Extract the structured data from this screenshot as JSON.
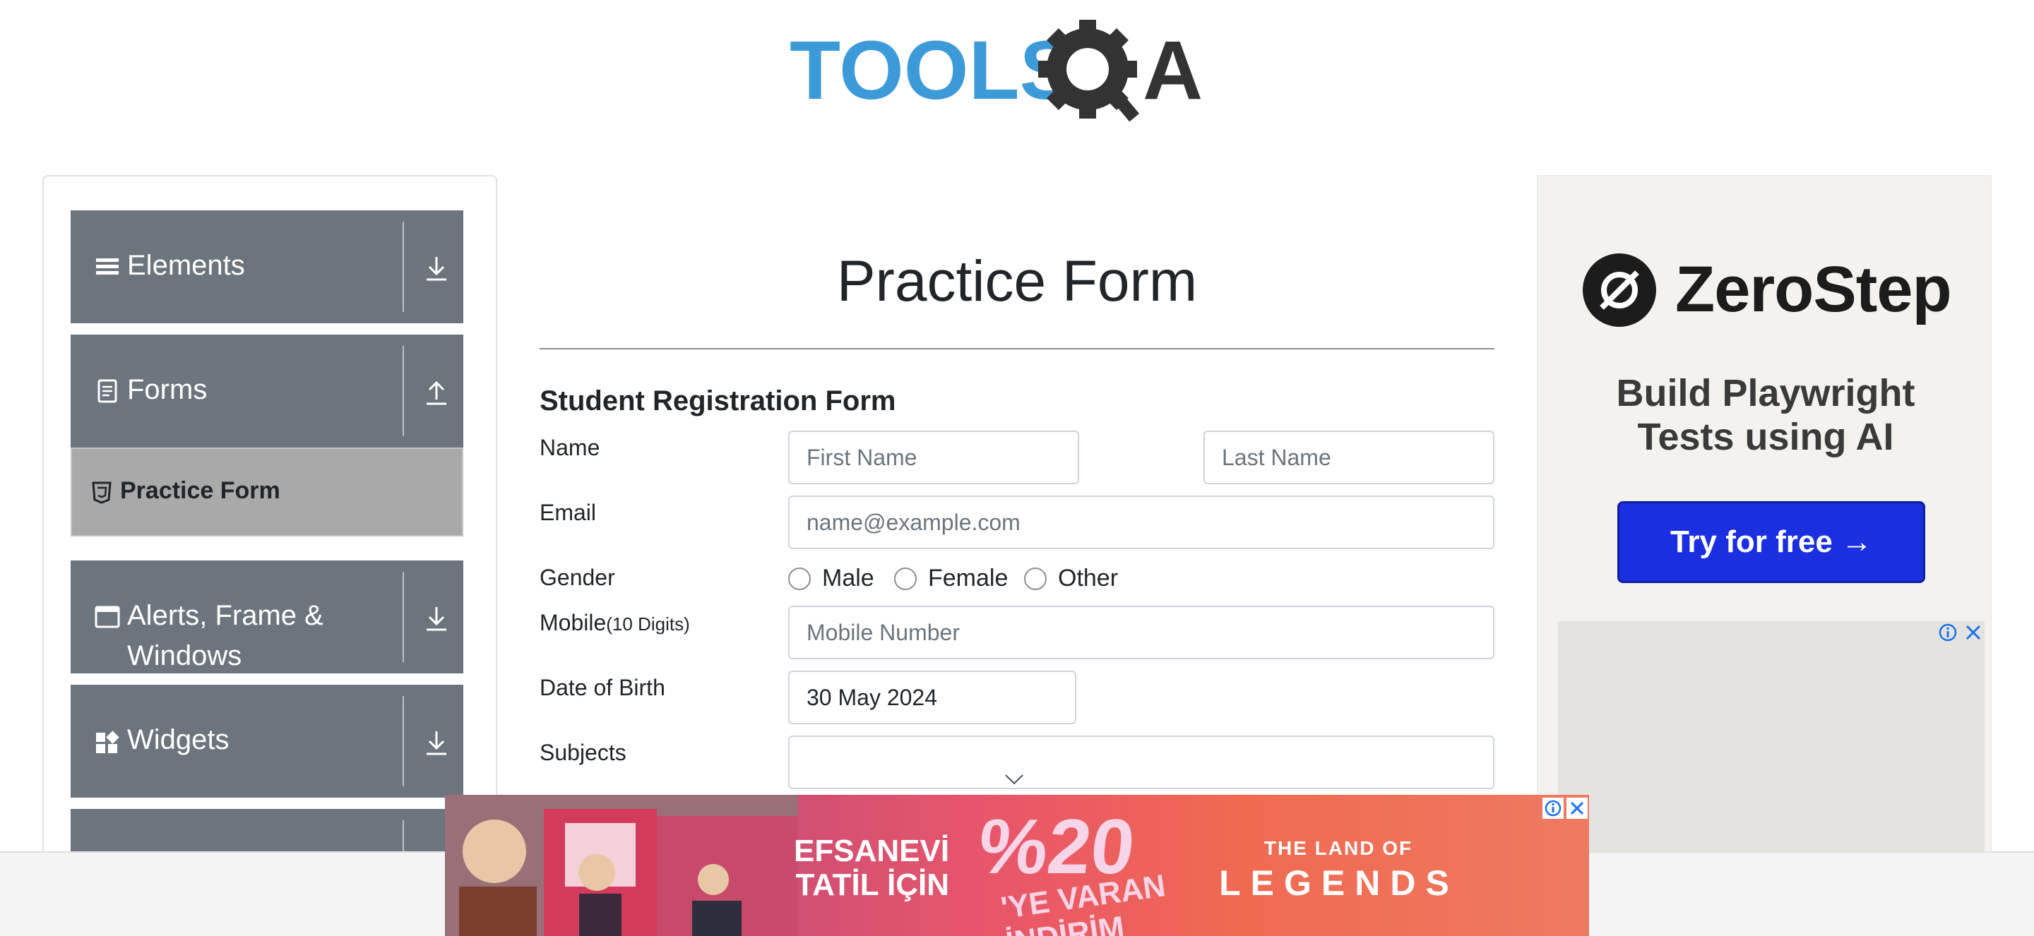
{
  "header": {
    "logo_text_left": "TOOLS",
    "logo_text_right": "A"
  },
  "sidebar": {
    "groups": [
      {
        "label": "Elements",
        "icon": "list-icon",
        "state": "collapsed"
      },
      {
        "label": "Forms",
        "icon": "document-icon",
        "state": "expanded"
      },
      {
        "label": "Alerts, Frame &",
        "label2": "Windows",
        "icon": "window-icon",
        "state": "collapsed"
      },
      {
        "label": "Widgets",
        "icon": "widgets-icon",
        "state": "collapsed"
      }
    ],
    "active_item": "Practice Form"
  },
  "main": {
    "title": "Practice Form",
    "form_title": "Student Registration Form",
    "name": {
      "label": "Name",
      "first_placeholder": "First Name",
      "last_placeholder": "Last Name"
    },
    "email": {
      "label": "Email",
      "placeholder": "name@example.com"
    },
    "gender": {
      "label": "Gender",
      "options": [
        "Male",
        "Female",
        "Other"
      ]
    },
    "mobile": {
      "label": "Mobile",
      "hint": "(10 Digits)",
      "placeholder": "Mobile Number"
    },
    "dob": {
      "label": "Date of Birth",
      "value": "30 May 2024"
    },
    "subjects": {
      "label": "Subjects",
      "value": ""
    }
  },
  "ad_right": {
    "brand": "ZeroStep",
    "tagline_line1": "Build Playwright",
    "tagline_line2": "Tests using AI",
    "cta": "Try for free →",
    "accent": "#1a2fe0"
  },
  "banner": {
    "left_line1": "EFSANEVİ",
    "left_line2": "TATİL İÇİN",
    "percent": "%20",
    "percent_sub1": "'YE VARAN",
    "percent_sub2": "İNDİRİM",
    "right_line1": "THE LAND OF",
    "right_line2": "LEGENDS"
  },
  "colors": {
    "sidebar_group": "#6c757d",
    "active_item": "#a9a9a9",
    "logo_blue": "#3d9ad8",
    "logo_dark": "#333333"
  }
}
